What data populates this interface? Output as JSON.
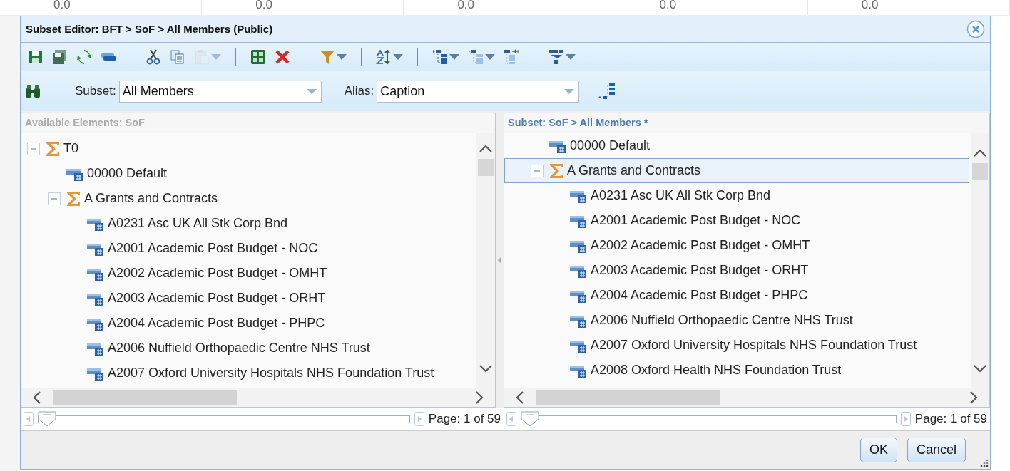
{
  "background": {
    "column_values": [
      "0.0",
      "0.0",
      "0.0",
      "0.0",
      "0.0"
    ]
  },
  "window": {
    "title": "Subset Editor: BFT > SoF > All Members (Public)"
  },
  "toolbar": {
    "groups": [
      [
        {
          "disabled": false,
          "dropdown": false
        },
        {
          "disabled": false,
          "dropdown": false
        },
        {
          "disabled": false,
          "dropdown": false
        },
        {
          "disabled": false,
          "dropdown": false
        }
      ],
      [
        {
          "disabled": false,
          "dropdown": false
        },
        {
          "disabled": false,
          "dropdown": false
        },
        {
          "disabled": true,
          "dropdown": true
        }
      ],
      [
        {
          "disabled": false,
          "dropdown": false
        },
        {
          "disabled": false,
          "dropdown": false
        }
      ],
      [
        {
          "disabled": false,
          "dropdown": true
        }
      ],
      [
        {
          "disabled": false,
          "dropdown": true
        }
      ],
      [
        {
          "disabled": false,
          "dropdown": true
        },
        {
          "disabled": false,
          "dropdown": true
        },
        {
          "disabled": false,
          "dropdown": false
        }
      ],
      [
        {
          "disabled": false,
          "dropdown": true
        }
      ]
    ]
  },
  "filter_bar": {
    "subset_label": "Subset:",
    "subset_value": "All Members",
    "alias_label": "Alias:",
    "alias_value": "Caption"
  },
  "panels": [
    {
      "title": "Available Elements: SoF",
      "active": false,
      "tree": [
        {
          "kind": "consolidated",
          "label": "T0",
          "expanded": true,
          "selected": false,
          "children": [
            {
              "kind": "leaf",
              "label": "00000 Default",
              "selected": false
            },
            {
              "kind": "consolidated",
              "label": "A Grants and Contracts",
              "expanded": true,
              "selected": false,
              "children": [
                {
                  "kind": "leaf",
                  "label": "A0231 Asc UK All Stk Corp Bnd",
                  "selected": false
                },
                {
                  "kind": "leaf",
                  "label": "A2001 Academic Post Budget - NOC",
                  "selected": false
                },
                {
                  "kind": "leaf",
                  "label": "A2002 Academic Post Budget - OMHT",
                  "selected": false
                },
                {
                  "kind": "leaf",
                  "label": "A2003 Academic Post Budget - ORHT",
                  "selected": false
                },
                {
                  "kind": "leaf",
                  "label": "A2004 Academic Post Budget - PHPC",
                  "selected": false
                },
                {
                  "kind": "leaf",
                  "label": "A2006 Nuffield Orthopaedic Centre NHS Trust",
                  "selected": false
                },
                {
                  "kind": "leaf",
                  "label": "A2007 Oxford University Hospitals NHS Foundation Trust",
                  "selected": false
                }
              ]
            }
          ]
        }
      ],
      "pager": {
        "level": 0,
        "text": "Page: 1 of 59"
      }
    },
    {
      "title": "Subset: SoF > All Members *",
      "active": true,
      "tree": [
        {
          "kind": "leaf",
          "label": "00000 Default",
          "selected": false
        },
        {
          "kind": "consolidated",
          "label": "A Grants and Contracts",
          "expanded": true,
          "selected": true,
          "children": [
            {
              "kind": "leaf",
              "label": "A0231 Asc UK All Stk Corp Bnd",
              "selected": false
            },
            {
              "kind": "leaf",
              "label": "A2001 Academic Post Budget - NOC",
              "selected": false
            },
            {
              "kind": "leaf",
              "label": "A2002 Academic Post Budget - OMHT",
              "selected": false
            },
            {
              "kind": "leaf",
              "label": "A2003 Academic Post Budget - ORHT",
              "selected": false
            },
            {
              "kind": "leaf",
              "label": "A2004 Academic Post Budget - PHPC",
              "selected": false
            },
            {
              "kind": "leaf",
              "label": "A2006 Nuffield Orthopaedic Centre NHS Trust",
              "selected": false
            },
            {
              "kind": "leaf",
              "label": "A2007 Oxford University Hospitals NHS Foundation Trust",
              "selected": false
            },
            {
              "kind": "leaf",
              "label": "A2008 Oxford Health NHS Foundation Trust",
              "selected": false
            }
          ]
        }
      ],
      "pager": {
        "level": 0,
        "text": "Page: 1 of 59"
      }
    }
  ],
  "buttons": [
    "OK",
    "Cancel"
  ]
}
